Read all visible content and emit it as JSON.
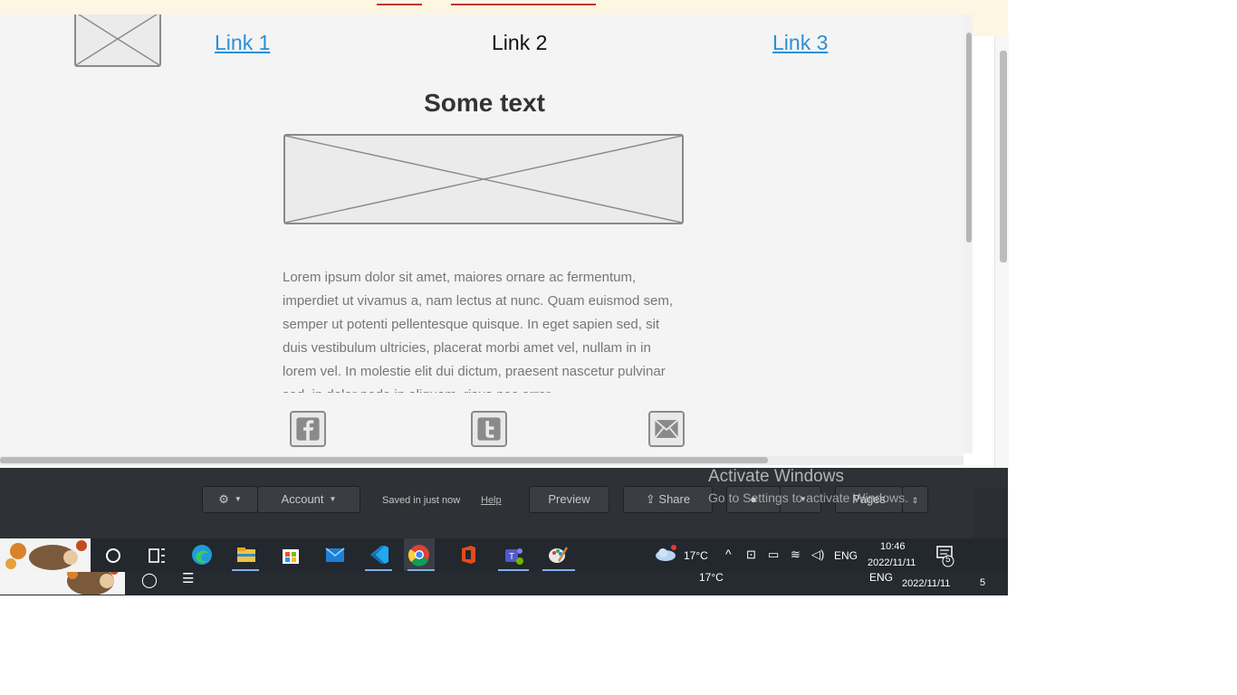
{
  "nav": {
    "link1": "Link 1",
    "link2": "Link 2",
    "link3": "Link 3"
  },
  "content": {
    "heading": "Some text",
    "body": "Lorem ipsum dolor sit amet, maiores ornare ac fermentum, imperdiet ut vivamus a, nam lectus at nunc. Quam euismod sem, semper ut potenti pellentesque quisque. In eget sapien sed, sit duis vestibulum ultricies, placerat morbi amet vel, nullam in in lorem vel. In molestie elit dui dictum, praesent nascetur pulvinar sed, in dolor pede in aliquam, risus nec error."
  },
  "social_icons": [
    "facebook-icon",
    "twitter-icon",
    "email-icon"
  ],
  "toolbar": {
    "account_label": "Account",
    "saved_status": "Saved in just now",
    "help_label": "Help",
    "preview_label": "Preview",
    "share_label": "Share",
    "pages_label": "Pages"
  },
  "activation": {
    "title": "Activate Windows",
    "subtitle": "Go to Settings to activate Windows."
  },
  "taskbar": {
    "temperature": "17°C",
    "language": "ENG",
    "time": "10:46",
    "date": "2022/11/11",
    "notification_count": "5",
    "pinned_apps": [
      "search-icon",
      "task-view-icon",
      "edge-icon",
      "file-explorer-icon",
      "store-icon",
      "mail-icon",
      "vscode-icon",
      "chrome-icon",
      "office-icon",
      "teams-icon",
      "paint-icon"
    ]
  },
  "taskbar_back": {
    "temperature": "17°C",
    "language": "ENG",
    "date": "2022/11/11",
    "notification_count": "5"
  },
  "colors": {
    "link": "#2b8fd6",
    "toolbar_bg": "#2e3135",
    "taskbar_bg": "#23272e",
    "canvas_bg": "#f4f4f4"
  }
}
